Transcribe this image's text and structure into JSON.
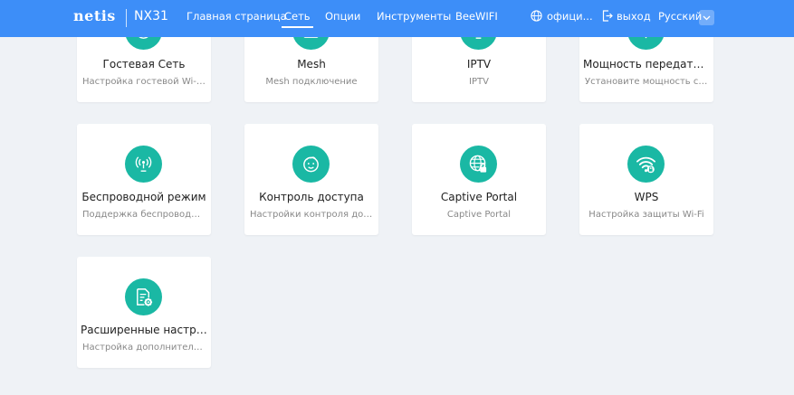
{
  "header": {
    "logo": "netis",
    "model": "NX31",
    "nav": [
      {
        "label": "Главная страница"
      },
      {
        "label": "Сеть"
      },
      {
        "label": "Опции"
      },
      {
        "label": "Инструменты"
      },
      {
        "label": "BeeWIFI"
      }
    ],
    "official_label": "офици...",
    "logout_label": "выход",
    "language": "Русский",
    "accent_color": "#3d8ef8"
  },
  "cards": [
    {
      "title": "Гостевая Сеть",
      "desc": "Настройка гостевой Wi-Fi сети",
      "icon": "guest-network-icon"
    },
    {
      "title": "Mesh",
      "desc": "Mesh подключение",
      "icon": "mesh-icon"
    },
    {
      "title": "IPTV",
      "desc": "IPTV",
      "icon": "iptv-icon"
    },
    {
      "title": "Мощность передатчика",
      "desc": "Установите мощность сигнала",
      "icon": "tx-power-icon"
    },
    {
      "title": "Беспроводной режим",
      "desc": "Поддержка беспроводного режима",
      "icon": "wireless-mode-icon"
    },
    {
      "title": "Контроль доступа",
      "desc": "Настройки контроля доступа",
      "icon": "access-control-icon"
    },
    {
      "title": "Captive Portal",
      "desc": "Captive Portal",
      "icon": "captive-portal-icon"
    },
    {
      "title": "WPS",
      "desc": "Настройка защиты Wi-Fi",
      "icon": "wps-icon"
    },
    {
      "title": "Расширенные настройки",
      "desc": "Настройка дополнительных параметров",
      "icon": "advanced-settings-icon"
    }
  ],
  "icon_color": "#1ab8a4"
}
